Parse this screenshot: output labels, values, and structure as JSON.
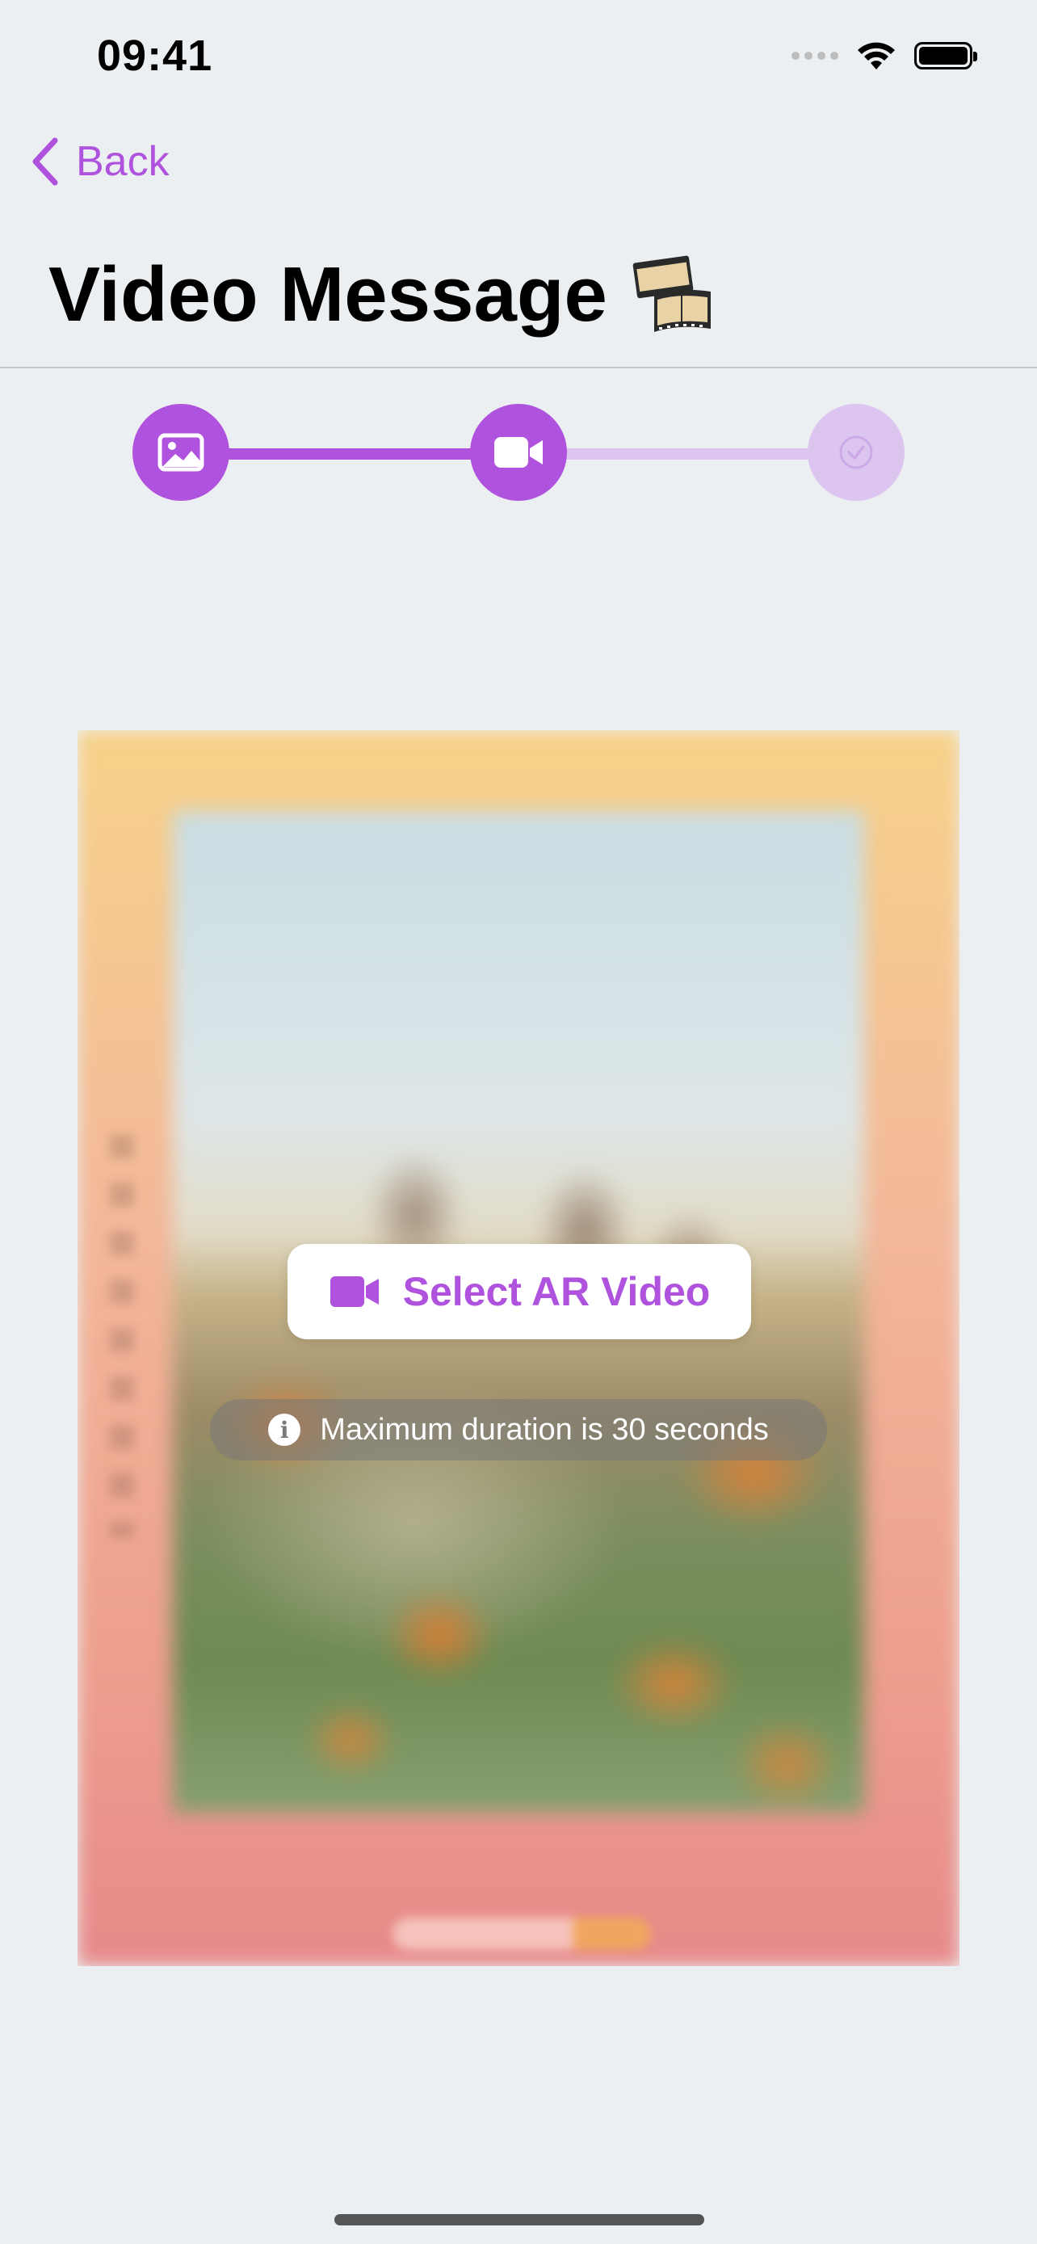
{
  "status_bar": {
    "time": "09:41"
  },
  "nav": {
    "back_label": "Back"
  },
  "header": {
    "title": "Video Message",
    "title_emoji": "🎞️"
  },
  "stepper": {
    "steps": [
      {
        "icon": "image-icon",
        "state": "completed"
      },
      {
        "icon": "video-camera-icon",
        "state": "current"
      },
      {
        "icon": "checkmark-icon",
        "state": "upcoming"
      }
    ],
    "accent_color": "#AF52DE",
    "inactive_color": "#DCC5EE"
  },
  "preview": {
    "select_button_label": "Select AR Video",
    "info_text": "Maximum duration is 30 seconds"
  },
  "colors": {
    "accent": "#AF52DE",
    "background": "#ECEFF1"
  }
}
